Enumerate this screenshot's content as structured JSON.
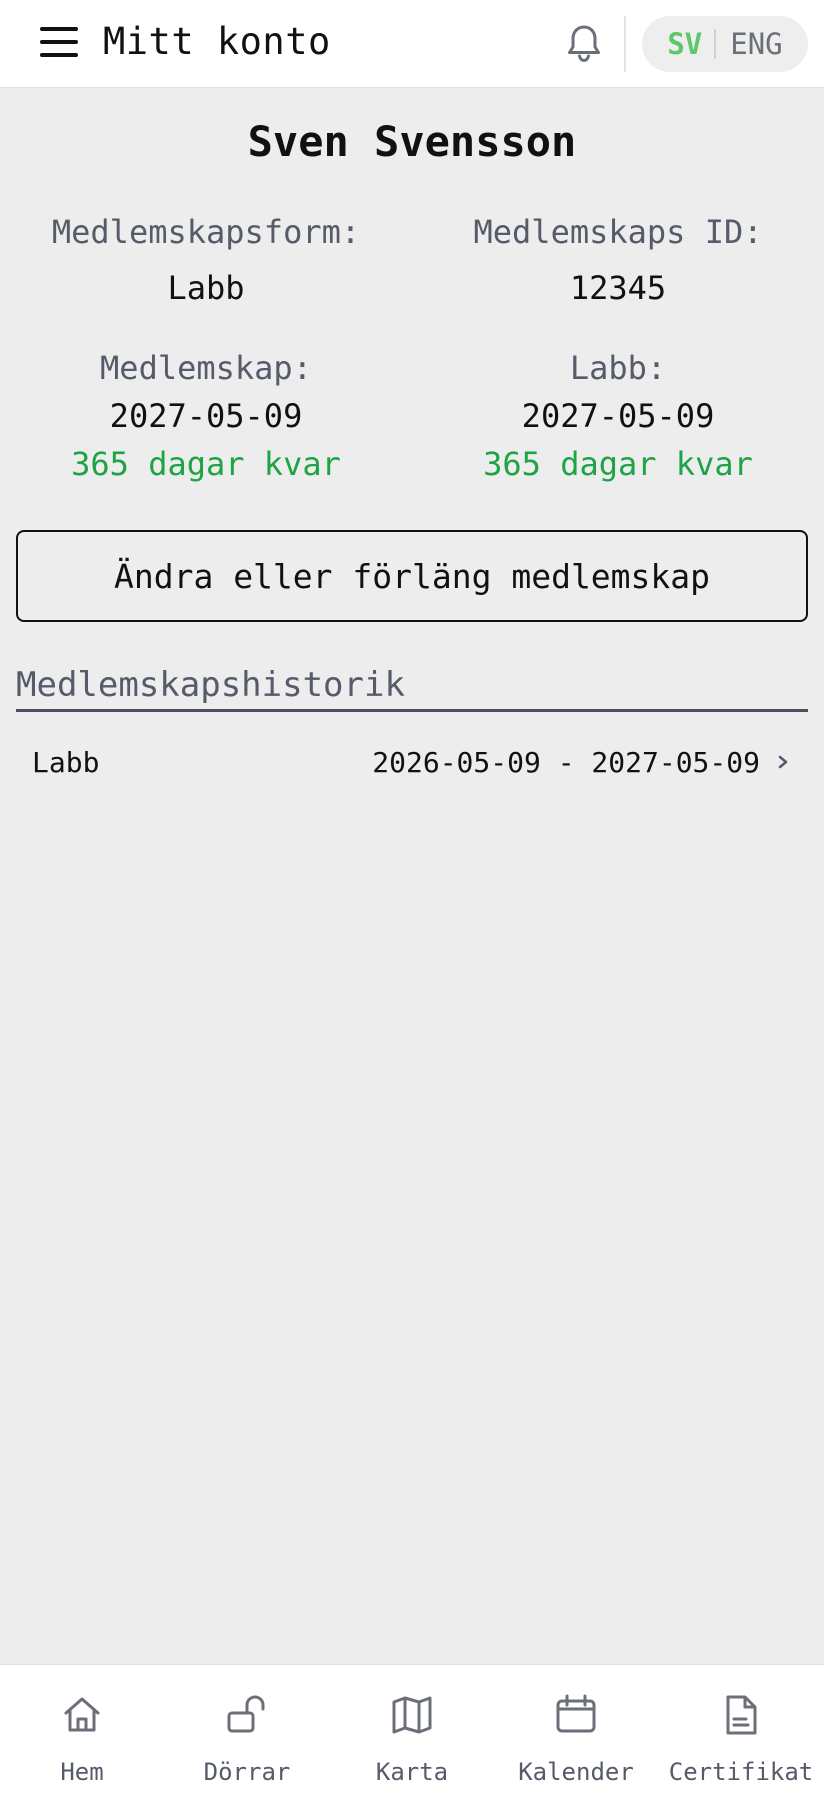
{
  "header": {
    "title": "Mitt konto",
    "lang_active": "SV",
    "lang_other": "ENG"
  },
  "account": {
    "name": "Sven Svensson",
    "membership_type_label": "Medlemskapsform:",
    "membership_type_value": "Labb",
    "membership_id_label": "Medlemskaps ID:",
    "membership_id_value": "12345",
    "membership_label": "Medlemskap:",
    "membership_date": "2027-05-09",
    "membership_days": "365 dagar kvar",
    "lab_label": "Labb:",
    "lab_date": "2027-05-09",
    "lab_days": "365 dagar kvar"
  },
  "actions": {
    "change_membership": "Ändra eller förläng medlemskap"
  },
  "history": {
    "title": "Medlemskapshistorik",
    "items": [
      {
        "type": "Labb",
        "period": "2026-05-09 - 2027-05-09"
      }
    ]
  },
  "bottom_nav": {
    "items": [
      {
        "label": "Hem",
        "icon": "home-icon"
      },
      {
        "label": "Dörrar",
        "icon": "unlock-icon"
      },
      {
        "label": "Karta",
        "icon": "map-icon"
      },
      {
        "label": "Kalender",
        "icon": "calendar-icon"
      },
      {
        "label": "Certifikat",
        "icon": "document-icon"
      }
    ]
  },
  "colors": {
    "accent_green": "#1ea345",
    "lang_active": "#5ec769",
    "background": "#ededee",
    "muted_text": "#555b68"
  }
}
